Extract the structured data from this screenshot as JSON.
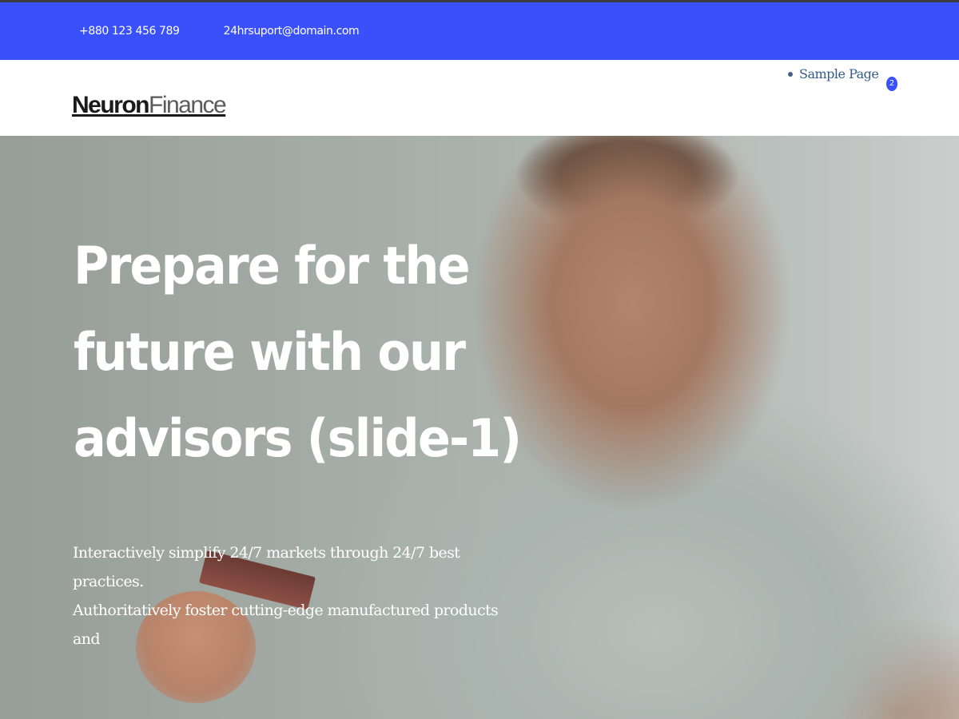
{
  "topbar": {
    "phone": "+880 123 456 789",
    "email": "24hrsuport@domain.com"
  },
  "header": {
    "logo_bold": "Neuron",
    "logo_light": "Finance",
    "nav_items": [
      {
        "label": "Sample Page"
      }
    ],
    "cart_count": "2"
  },
  "hero": {
    "title": "Prepare for the future with our advisors (slide-1)",
    "text_line1": "Interactively simplify 24/7 markets through 24/7 best practices.",
    "text_line2": "Authoritatively foster cutting-edge manufactured products and"
  },
  "colors": {
    "accent": "#3a50fb",
    "nav_link": "#34598c",
    "logo": "#1a1a1a"
  }
}
